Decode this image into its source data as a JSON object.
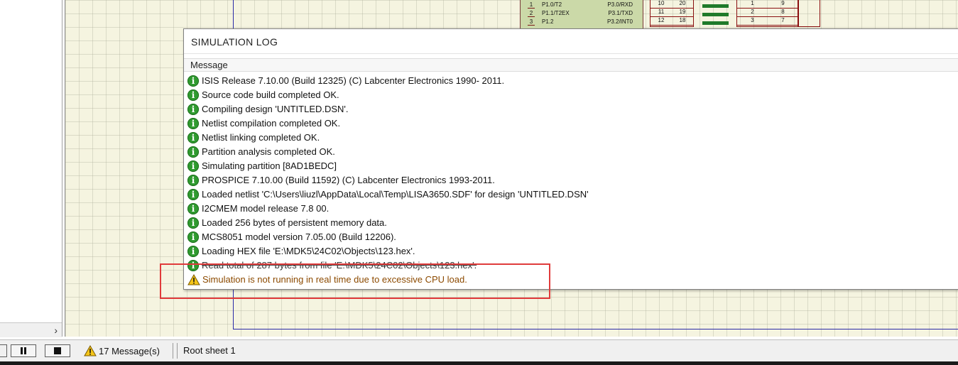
{
  "window": {
    "title": "SIMULATION LOG",
    "column_header": "Message"
  },
  "messages": [
    {
      "type": "info",
      "text": "ISIS Release 7.10.00 (Build 12325) (C) Labcenter Electronics 1990- 2011."
    },
    {
      "type": "info",
      "text": "Source code build completed OK."
    },
    {
      "type": "info",
      "text": "Compiling design 'UNTITLED.DSN'."
    },
    {
      "type": "info",
      "text": "Netlist compilation completed OK."
    },
    {
      "type": "info",
      "text": "Netlist linking completed OK."
    },
    {
      "type": "info",
      "text": "Partition analysis completed OK."
    },
    {
      "type": "info",
      "text": "Simulating partition [8AD1BEDC]"
    },
    {
      "type": "info",
      "text": "PROSPICE 7.10.00 (Build 11592) (C) Labcenter Electronics 1993-2011."
    },
    {
      "type": "info",
      "text": "Loaded netlist 'C:\\Users\\liuzl\\AppData\\Local\\Temp\\LISA3650.SDF' for design 'UNTITLED.DSN'"
    },
    {
      "type": "info",
      "text": "I2CMEM model release 7.8 00."
    },
    {
      "type": "info",
      "text": "Loaded 256 bytes of persistent memory data."
    },
    {
      "type": "info",
      "text": "MCS8051 model version 7.05.00 (Build 12206)."
    },
    {
      "type": "info",
      "text": "Loading HEX file 'E:\\MDK5\\24C02\\Objects\\123.hex'."
    },
    {
      "type": "info",
      "text": "Read total of 287 bytes from file 'E:\\MDK5\\24C02\\Objects\\123.hex'.",
      "struck": true
    },
    {
      "type": "warning",
      "text": "Simulation is not running in real time due to excessive CPU load."
    }
  ],
  "schematic": {
    "chip_rows": [
      {
        "pin": "1",
        "left_name": "P1.0/T2",
        "right_name": "P3.0/RXD"
      },
      {
        "pin": "2",
        "left_name": "P1.1/T2EX",
        "right_name": "P3.1/TXD"
      },
      {
        "pin": "3",
        "left_name": "P1.2",
        "right_name": "P3.2/INT0"
      }
    ],
    "pin_box_rows": [
      {
        "a": "10",
        "b": "20"
      },
      {
        "a": "11",
        "b": "19"
      },
      {
        "a": "12",
        "b": "18"
      }
    ],
    "right_pin_box_rows": [
      {
        "a": "1",
        "b": "9"
      },
      {
        "a": "2",
        "b": "8"
      },
      {
        "a": "3",
        "b": "7"
      }
    ]
  },
  "status_bar": {
    "messages_label": "17 Message(s)",
    "sheet_label": "Root sheet 1"
  },
  "left_panel": {
    "scroll_arrow": "›"
  },
  "colors": {
    "info_icon": "#2f9a2f",
    "warning_text": "#8c4a00",
    "highlight_box": "#e03b3b",
    "sheet_border": "#2a2aa8",
    "grid_background": "#f5f4e0"
  }
}
